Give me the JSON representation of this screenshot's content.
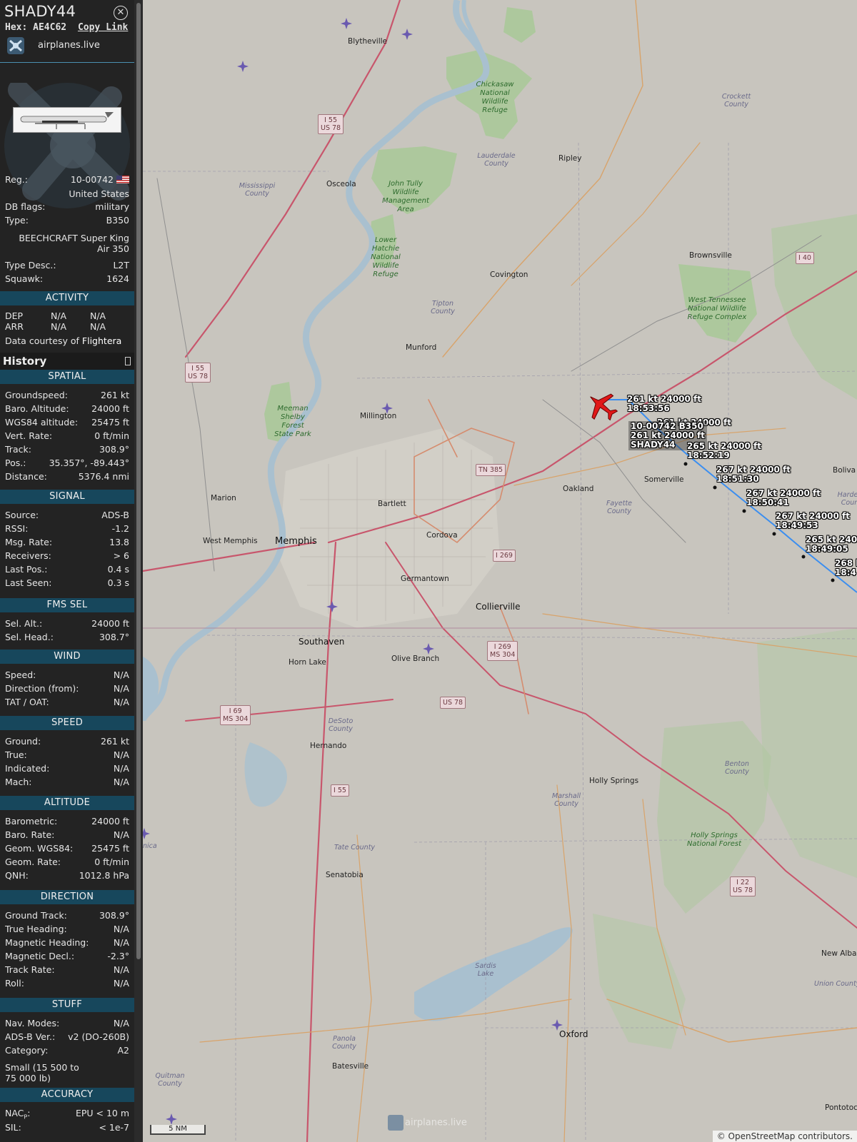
{
  "aircraft": {
    "callsign": "SHADY44",
    "hex_label": "Hex:",
    "hex": "AE4C62",
    "copy_link": "Copy Link",
    "source_name": "airplanes.live"
  },
  "info": {
    "reg_label": "Reg.:",
    "reg": "10-00742",
    "country": "United States",
    "dbflags_label": "DB flags:",
    "dbflags": "military",
    "type_label": "Type:",
    "type": "B350",
    "type_full_1": "BEECHCRAFT Super King",
    "type_full_2": "Air 350",
    "typedesc_label": "Type Desc.:",
    "typedesc": "L2T",
    "squawk_label": "Squawk:",
    "squawk": "1624"
  },
  "activity": {
    "header": "ACTIVITY",
    "dep_label": "DEP",
    "dep_1": "N/A",
    "dep_2": "N/A",
    "arr_label": "ARR",
    "arr_1": "N/A",
    "arr_2": "N/A",
    "courtesy": "Data courtesy of",
    "courtesy_brand": "Flightera"
  },
  "history": {
    "title": "History"
  },
  "spatial": {
    "header": "SPATIAL",
    "rows": [
      {
        "k": "Groundspeed:",
        "v": "261 kt"
      },
      {
        "k": "Baro. Altitude:",
        "v": "24000 ft"
      },
      {
        "k": "WGS84 altitude:",
        "v": "25475 ft"
      },
      {
        "k": "Vert. Rate:",
        "v": "0 ft/min"
      },
      {
        "k": "Track:",
        "v": "308.9°"
      },
      {
        "k": "Pos.:",
        "v": "35.357°, -89.443°"
      },
      {
        "k": "Distance:",
        "v": "5376.4 nmi"
      }
    ]
  },
  "signal": {
    "header": "SIGNAL",
    "rows": [
      {
        "k": "Source:",
        "v": "ADS-B"
      },
      {
        "k": "RSSI:",
        "v": "-1.2"
      },
      {
        "k": "Msg. Rate:",
        "v": "13.8"
      },
      {
        "k": "Receivers:",
        "v": "> 6"
      },
      {
        "k": "Last Pos.:",
        "v": "0.4 s"
      },
      {
        "k": "Last Seen:",
        "v": "0.3 s"
      }
    ]
  },
  "fms": {
    "header": "FMS SEL",
    "rows": [
      {
        "k": "Sel. Alt.:",
        "v": "24000 ft"
      },
      {
        "k": "Sel. Head.:",
        "v": "308.7°"
      }
    ]
  },
  "wind": {
    "header": "WIND",
    "rows": [
      {
        "k": "Speed:",
        "v": "N/A"
      },
      {
        "k": "Direction (from):",
        "v": "N/A"
      },
      {
        "k": "TAT / OAT:",
        "v": "N/A"
      }
    ]
  },
  "speed": {
    "header": "SPEED",
    "rows": [
      {
        "k": "Ground:",
        "v": "261 kt"
      },
      {
        "k": "True:",
        "v": "N/A"
      },
      {
        "k": "Indicated:",
        "v": "N/A"
      },
      {
        "k": "Mach:",
        "v": "N/A"
      }
    ]
  },
  "altitude": {
    "header": "ALTITUDE",
    "rows": [
      {
        "k": "Barometric:",
        "v": "24000 ft"
      },
      {
        "k": "Baro. Rate:",
        "v": "N/A"
      },
      {
        "k": "Geom. WGS84:",
        "v": "25475 ft"
      },
      {
        "k": "Geom. Rate:",
        "v": "0 ft/min"
      },
      {
        "k": "QNH:",
        "v": "1012.8 hPa"
      }
    ]
  },
  "direction": {
    "header": "DIRECTION",
    "rows": [
      {
        "k": "Ground Track:",
        "v": "308.9°"
      },
      {
        "k": "True Heading:",
        "v": "N/A"
      },
      {
        "k": "Magnetic Heading:",
        "v": "N/A"
      },
      {
        "k": "Magnetic Decl.:",
        "v": "-2.3°"
      },
      {
        "k": "Track Rate:",
        "v": "N/A"
      },
      {
        "k": "Roll:",
        "v": "N/A"
      }
    ]
  },
  "stuff": {
    "header": "STUFF",
    "rows": [
      {
        "k": "Nav. Modes:",
        "v": "N/A"
      },
      {
        "k": "ADS-B Ver.:",
        "v": "v2 (DO-260B)"
      },
      {
        "k": "Category:",
        "v": "A2"
      }
    ],
    "category_desc_1": "Small (15 500 to",
    "category_desc_2": "75 000 lb)"
  },
  "accuracy": {
    "header": "ACCURACY",
    "nacp_label": "NAC",
    "nacp_sub": "P",
    "nacp_suffix": ":",
    "nacp": "EPU < 10 m",
    "sil_label": "SIL:",
    "sil": "< 1e-7"
  },
  "map": {
    "aircraft_label": {
      "speed_alt": "261 kt  24000 ft",
      "time": "18:53:56",
      "reg_type": "10-00742 B350",
      "speed_alt_2": "261 kt  24000 ft",
      "callsign": "SHADY44"
    },
    "track_labels": [
      {
        "speed_alt": "261 kt  24000 ft",
        "time": ""
      },
      {
        "speed_alt": "265 kt  24000 ft",
        "time": "18:52:19"
      },
      {
        "speed_alt": "267 kt  24000 ft",
        "time": "18:51:30"
      },
      {
        "speed_alt": "267 kt  24000 ft",
        "time": "18:50:41"
      },
      {
        "speed_alt": "267 kt  24000 ft",
        "time": "18:49:53"
      },
      {
        "speed_alt": "265 kt  240",
        "time": "18:49:05"
      },
      {
        "speed_alt": "268 k",
        "time": "18:4"
      }
    ],
    "cities": {
      "memphis": "Memphis",
      "west_memphis": "West Memphis",
      "marion": "Marion",
      "bartlett": "Bartlett",
      "cordova": "Cordova",
      "germantown": "Germantown",
      "collierville": "Collierville",
      "southaven": "Southaven",
      "horn_lake": "Horn Lake",
      "olive_branch": "Olive Branch",
      "hernando": "Hernando",
      "millington": "Millington",
      "munford": "Munford",
      "covington": "Covington",
      "osceola": "Osceola",
      "blytheville": "Blytheville",
      "ripley": "Ripley",
      "brownsville": "Brownsville",
      "somerville": "Somerville",
      "oakland": "Oakland",
      "holly_springs": "Holly Springs",
      "senatobia": "Senatobia",
      "batesville": "Batesville",
      "oxford": "Oxford",
      "new_albany": "New Albany",
      "pontotoc": "Pontotoc",
      "bolivar": "Boliva"
    },
    "counties": {
      "mississippi": "Mississippi County",
      "lauderdale": "Lauderdale County",
      "tipton": "Tipton County",
      "crockett": "Crockett County",
      "fayette": "Fayette County",
      "hardeman": "Harden Coun",
      "desoto": "DeSoto County",
      "marshall": "Marshall County",
      "benton": "Benton County",
      "tate": "Tate County",
      "panola": "Panola County",
      "quitman": "Quitman County",
      "union": "Union County",
      "tunica": "nica"
    },
    "parks": {
      "chickasaw": "Chickasaw National Wildlife Refuge",
      "john_tully": "John Tully Wildlife Management Area",
      "lower_hatchie": "Lower Hatchie National Wildlife Refuge",
      "meeman": "Meeman Shelby Forest State Park",
      "west_tn": "West Tennessee National Wildlife Refuge Complex",
      "holly_springs_nf": "Holly Springs National Forest",
      "sardis": "Sardis Lake"
    },
    "shields": {
      "i55_us78_n": [
        "I 55",
        "US 78"
      ],
      "i55_us78_w": [
        "I 55",
        "US 78"
      ],
      "i40": [
        "I 40"
      ],
      "tn385": [
        "TN 385"
      ],
      "i269": [
        "I 269"
      ],
      "i269_ms304": [
        "I 269",
        "MS 304"
      ],
      "us78": [
        "US 78"
      ],
      "i69_ms304": [
        "I 69",
        "MS 304"
      ],
      "i55": [
        "I 55"
      ],
      "i22_us78": [
        "I 22",
        "US 78"
      ]
    },
    "scale": "5 NM",
    "watermark": "airplanes.live",
    "attribution": "© OpenStreetMap contributors."
  }
}
